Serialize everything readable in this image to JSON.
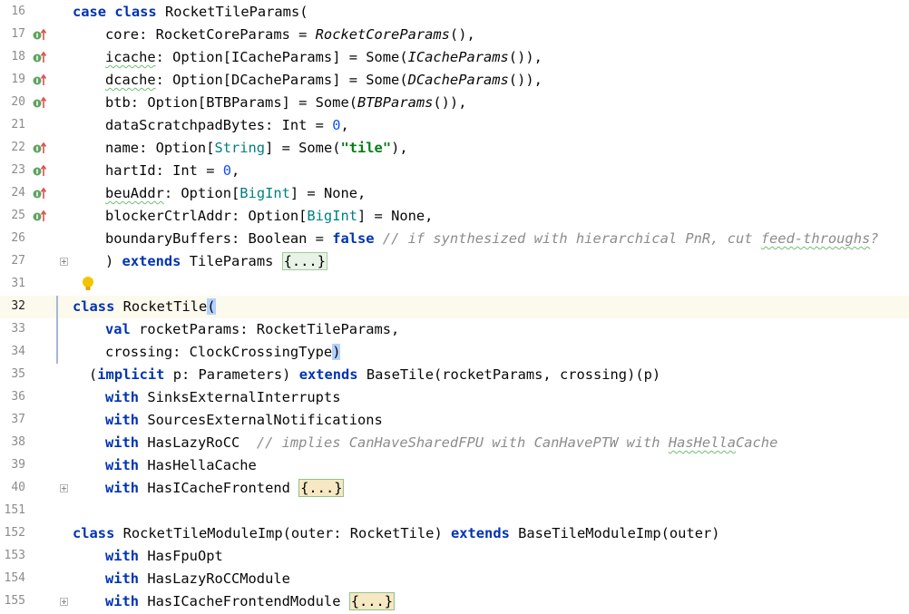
{
  "lines": [
    {
      "n": "16",
      "parts": [
        {
          "t": "case ",
          "c": "kw"
        },
        {
          "t": "class ",
          "c": "kw"
        },
        {
          "t": "RocketTileParams("
        }
      ]
    },
    {
      "n": "17",
      "impl": true,
      "ind": 1,
      "parts": [
        {
          "t": "core: RocketCoreParams = "
        },
        {
          "t": "RocketCoreParams",
          "c": "fn"
        },
        {
          "t": "(),"
        }
      ]
    },
    {
      "n": "18",
      "impl": true,
      "ind": 1,
      "parts": [
        {
          "t": "icache",
          "c": "wavy"
        },
        {
          "t": ": Option[ICacheParams] = Some("
        },
        {
          "t": "ICacheParams",
          "c": "fn"
        },
        {
          "t": "()),"
        }
      ]
    },
    {
      "n": "19",
      "impl": true,
      "ind": 1,
      "parts": [
        {
          "t": "dcache",
          "c": "wavy"
        },
        {
          "t": ": Option[DCacheParams] = Some("
        },
        {
          "t": "DCacheParams",
          "c": "fn"
        },
        {
          "t": "()),"
        }
      ]
    },
    {
      "n": "20",
      "impl": true,
      "ind": 1,
      "parts": [
        {
          "t": "btb: Option[BTBParams] = Some("
        },
        {
          "t": "BTBParams",
          "c": "fn"
        },
        {
          "t": "()),"
        }
      ]
    },
    {
      "n": "21",
      "ind": 1,
      "parts": [
        {
          "t": "dataScratchpadBytes: Int = "
        },
        {
          "t": "0",
          "c": "num"
        },
        {
          "t": ","
        }
      ]
    },
    {
      "n": "22",
      "impl": true,
      "ind": 1,
      "parts": [
        {
          "t": "name: Option["
        },
        {
          "t": "String",
          "c": "typ"
        },
        {
          "t": "] = Some("
        },
        {
          "t": "\"tile\"",
          "c": "str"
        },
        {
          "t": "),"
        }
      ]
    },
    {
      "n": "23",
      "impl": true,
      "ind": 1,
      "parts": [
        {
          "t": "hartId: Int = "
        },
        {
          "t": "0",
          "c": "num"
        },
        {
          "t": ","
        }
      ]
    },
    {
      "n": "24",
      "impl": true,
      "ind": 1,
      "parts": [
        {
          "t": "beuAddr",
          "c": "wavy"
        },
        {
          "t": ": Option["
        },
        {
          "t": "BigInt",
          "c": "typ"
        },
        {
          "t": "] = None,"
        }
      ]
    },
    {
      "n": "25",
      "impl": true,
      "ind": 1,
      "parts": [
        {
          "t": "blockerCtrlAddr: Option["
        },
        {
          "t": "BigInt",
          "c": "typ"
        },
        {
          "t": "] = None,"
        }
      ]
    },
    {
      "n": "26",
      "ind": 1,
      "parts": [
        {
          "t": "boundaryBuffers: Boolean = "
        },
        {
          "t": "false ",
          "c": "kw"
        },
        {
          "t": "// if synthesized with hierarchical PnR, cut ",
          "c": "cmt"
        },
        {
          "t": "feed-throughs",
          "c": "cmt wavy"
        },
        {
          "t": "?",
          "c": "cmt"
        }
      ]
    },
    {
      "n": "27",
      "fold": true,
      "ind": 1,
      "parts": [
        {
          "t": ") "
        },
        {
          "t": "extends ",
          "c": "kw"
        },
        {
          "t": "TileParams "
        },
        {
          "t": "{...}",
          "c": "folded"
        }
      ]
    },
    {
      "n": "31",
      "bulb": true,
      "parts": []
    },
    {
      "n": "32",
      "current": true,
      "parts": [
        {
          "t": "class ",
          "c": "kw"
        },
        {
          "t": "RocketTile"
        },
        {
          "t": "(",
          "c": "brace"
        }
      ]
    },
    {
      "n": "33",
      "ind": 1,
      "parts": [
        {
          "t": "val ",
          "c": "kw"
        },
        {
          "t": "rocketParams: RocketTileParams,"
        }
      ]
    },
    {
      "n": "34",
      "ind": 1,
      "parts": [
        {
          "t": "crossing: ClockCrossingType"
        },
        {
          "t": ")",
          "c": "brace"
        }
      ]
    },
    {
      "n": "35",
      "ind": 2,
      "parts": [
        {
          "t": "("
        },
        {
          "t": "implicit ",
          "c": "kw"
        },
        {
          "t": "p: Parameters) "
        },
        {
          "t": "extends ",
          "c": "kw"
        },
        {
          "t": "BaseTile(rocketParams, crossing)(p)"
        }
      ]
    },
    {
      "n": "36",
      "ind": 1,
      "parts": [
        {
          "t": "with ",
          "c": "kw"
        },
        {
          "t": "SinksExternalInterrupts"
        }
      ]
    },
    {
      "n": "37",
      "ind": 1,
      "parts": [
        {
          "t": "with ",
          "c": "kw"
        },
        {
          "t": "SourcesExternalNotifications"
        }
      ]
    },
    {
      "n": "38",
      "ind": 1,
      "parts": [
        {
          "t": "with ",
          "c": "kw"
        },
        {
          "t": "HasLazyRoCC  "
        },
        {
          "t": "// implies CanHaveSharedFPU with CanHavePTW with ",
          "c": "cmt"
        },
        {
          "t": "HasHella",
          "c": "cmt wavy"
        },
        {
          "t": "Cache",
          "c": "cmt"
        }
      ]
    },
    {
      "n": "39",
      "ind": 1,
      "parts": [
        {
          "t": "with ",
          "c": "kw"
        },
        {
          "t": "HasHellaCache"
        }
      ]
    },
    {
      "n": "40",
      "fold": true,
      "ind": 1,
      "parts": [
        {
          "t": "with ",
          "c": "kw"
        },
        {
          "t": "HasICacheFrontend "
        },
        {
          "t": "{...}",
          "c": "folded sel"
        }
      ]
    },
    {
      "n": "151",
      "parts": []
    },
    {
      "n": "152",
      "parts": [
        {
          "t": "class ",
          "c": "kw"
        },
        {
          "t": "RocketTileModuleImp(outer: RocketTile) "
        },
        {
          "t": "extends ",
          "c": "kw"
        },
        {
          "t": "BaseTileModuleImp(outer)"
        }
      ]
    },
    {
      "n": "153",
      "ind": 1,
      "parts": [
        {
          "t": "with ",
          "c": "kw"
        },
        {
          "t": "HasFpuOpt"
        }
      ]
    },
    {
      "n": "154",
      "ind": 1,
      "parts": [
        {
          "t": "with ",
          "c": "kw"
        },
        {
          "t": "HasLazyRoCCModule"
        }
      ]
    },
    {
      "n": "155",
      "fold": true,
      "ind": 1,
      "parts": [
        {
          "t": "with ",
          "c": "kw"
        },
        {
          "t": "HasICacheFrontendModule "
        },
        {
          "t": "{...}",
          "c": "folded sel"
        }
      ]
    }
  ]
}
